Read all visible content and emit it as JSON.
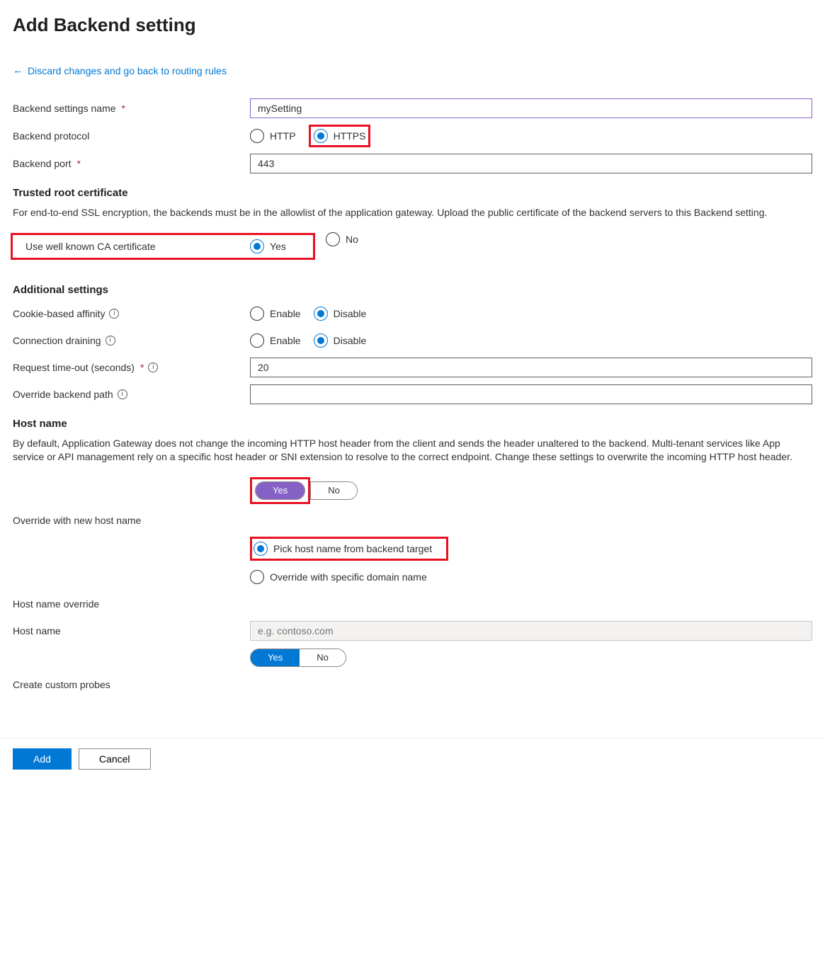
{
  "header": {
    "title": "Add Backend setting"
  },
  "backLink": {
    "arrow": "←",
    "text": "Discard changes and go back to routing rules"
  },
  "fields": {
    "settingsName": {
      "label": "Backend settings name",
      "value": "mySetting"
    },
    "protocol": {
      "label": "Backend protocol",
      "http": "HTTP",
      "https": "HTTPS"
    },
    "port": {
      "label": "Backend port",
      "value": "443"
    },
    "trustedRoot": {
      "heading": "Trusted root certificate",
      "description": "For end-to-end SSL encryption, the backends must be in the allowlist of the application gateway. Upload the public certificate of the backend servers to this Backend setting."
    },
    "wellKnownCA": {
      "label": "Use well known CA certificate",
      "yes": "Yes",
      "no": "No"
    },
    "additional": {
      "heading": "Additional settings"
    },
    "cookieAffinity": {
      "label": "Cookie-based affinity",
      "enable": "Enable",
      "disable": "Disable"
    },
    "connDraining": {
      "label": "Connection draining",
      "enable": "Enable",
      "disable": "Disable"
    },
    "timeout": {
      "label": "Request time-out (seconds)",
      "value": "20"
    },
    "overridePath": {
      "label": "Override backend path",
      "value": ""
    },
    "hostName": {
      "heading": "Host name",
      "description": "By default, Application Gateway does not change the incoming HTTP host header from the client and sends the header unaltered to the backend. Multi-tenant services like App service or API management rely on a specific host header or SNI extension to resolve to the correct endpoint. Change these settings to overwrite the incoming HTTP host header."
    },
    "overrideHost": {
      "yes": "Yes",
      "no": "No",
      "label": "Override with new host name",
      "opt1": "Pick host name from backend target",
      "opt2": "Override with specific domain name"
    },
    "hostOverrideLabel": "Host name override",
    "hostNameField": {
      "label": "Host name",
      "placeholder": "e.g. contoso.com"
    },
    "customProbes": {
      "label": "Create custom probes",
      "yes": "Yes",
      "no": "No"
    }
  },
  "footer": {
    "add": "Add",
    "cancel": "Cancel"
  }
}
